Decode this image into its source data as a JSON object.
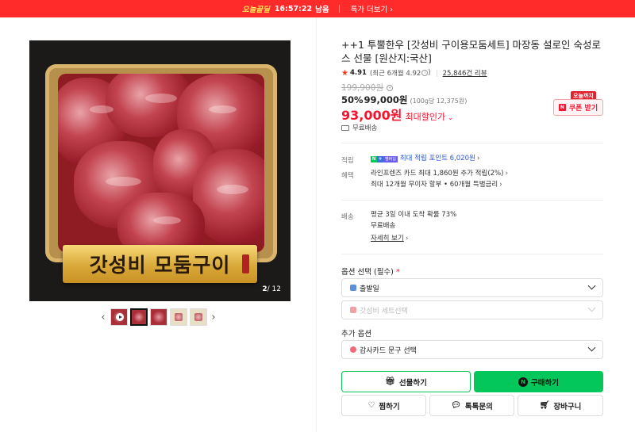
{
  "top_banner": {
    "brand": "오늘끝딜",
    "timer": "16:57:22",
    "timer_suffix": "남음",
    "more_link": "특가 더보기",
    "more_chevron": "›"
  },
  "gallery": {
    "overlay_text": "갓성비 모둠구이",
    "counter_current": "2",
    "counter_total": "/ 12",
    "prev_arrow": "‹",
    "next_arrow": "›",
    "thumbnails": [
      "video",
      "image",
      "image",
      "image",
      "image"
    ],
    "active_thumbnail": 2
  },
  "product": {
    "title": "++1 투뿔한우 [갓성비 구이용모둠세트] 마장동 설로인 숙성로스 선물 [원산지:국산]",
    "rating": "4.91",
    "rating_recent": "(최근 6개월 4.92",
    "reviews": "25,846건 리뷰",
    "original_price": "199,900원",
    "discount_pct": "50%",
    "discount_price": "99,000원",
    "unit_price": "(100g당 12,375원)",
    "sale_price": "93,000원",
    "sale_label": "최대할인가",
    "shipping_mini": "무료배송"
  },
  "coupon": {
    "badge": "오늘까지",
    "icon": "N",
    "label": "쿠폰 받기"
  },
  "benefits": {
    "points_label": "적립",
    "points_logo_n": "N",
    "points_logo_plus": "+",
    "points_logo_pay": "멤버십",
    "points_text": "최대 적립 포인트 6,020원",
    "benefit_label": "혜택",
    "benefit_line1": "라인프렌즈 카드 최대 1,860원 추가 적립(2%)",
    "benefit_line2": "최대 12개월 무이자 할부 • 60개월 특별금리"
  },
  "delivery": {
    "label": "배송",
    "line1": "평균 3일 이내 도착 확률 73%",
    "line2": "무료배송",
    "details_link": "자세히 보기"
  },
  "options": {
    "required_title": "옵션 선택 (필수)",
    "required_mark": "*",
    "select1": "출발일",
    "select2": "갓성비 세트선택",
    "extra_title": "추가 옵션",
    "select3": "감사카드 문구 선택"
  },
  "actions": {
    "gift": "선물하기",
    "buy": "구매하기",
    "wish": "찜하기",
    "talk": "톡톡문의",
    "cart": "장바구니"
  },
  "colors": {
    "banner_red": "#ff2a2a",
    "sale_red": "#f4142e",
    "naver_green": "#03c75a"
  }
}
